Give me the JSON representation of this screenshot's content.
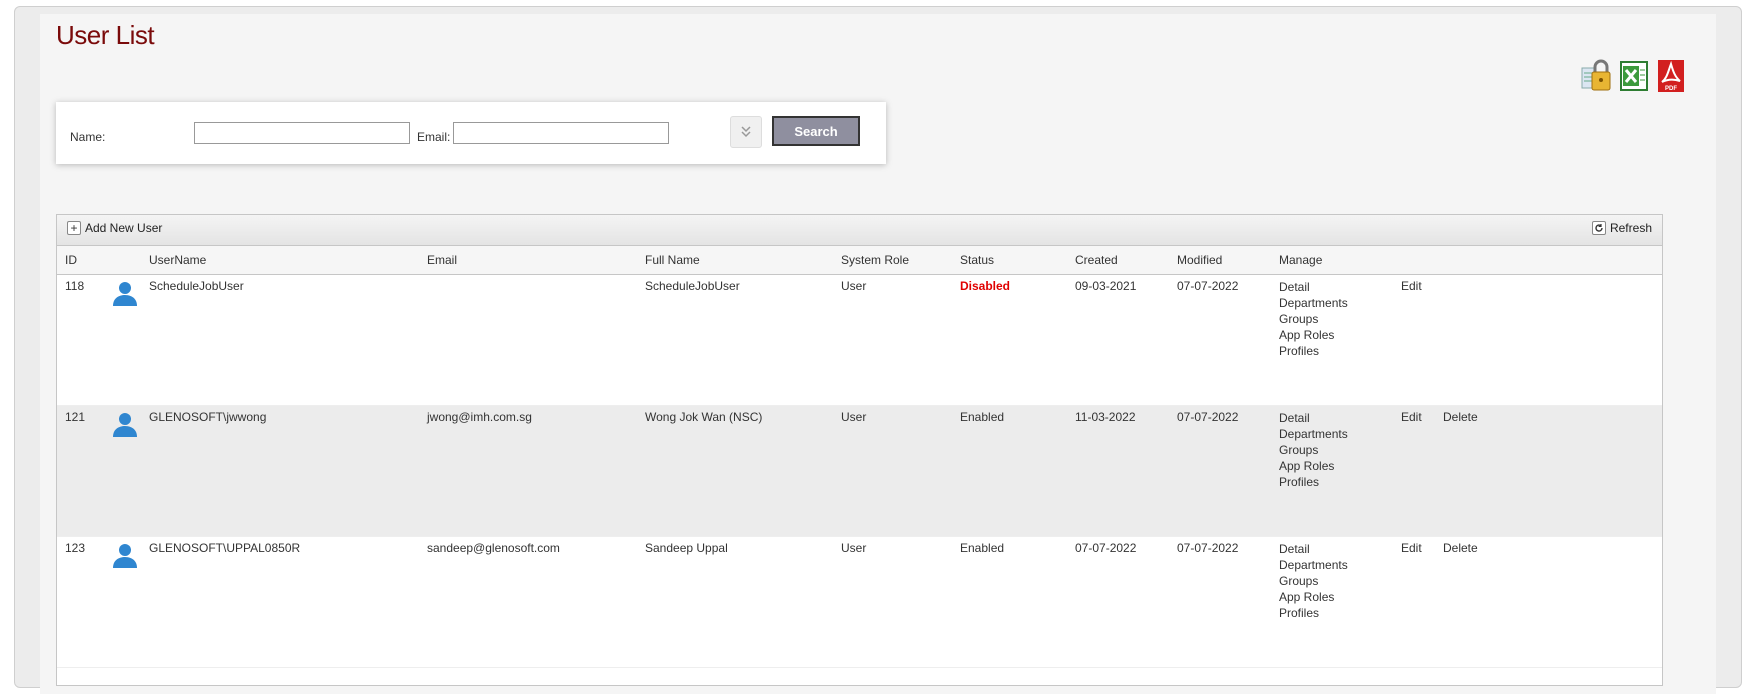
{
  "page": {
    "title": "User List"
  },
  "export_icons": [
    "lock-permissions-icon",
    "excel-export-icon",
    "pdf-export-icon"
  ],
  "search": {
    "name_label": "Name:",
    "name_value": "",
    "email_label": "Email:",
    "email_value": "",
    "expand_icon": "double-chevron-down-icon",
    "button_label": "Search"
  },
  "toolbar": {
    "add_label": "Add New User",
    "refresh_label": "Refresh"
  },
  "columns": [
    "ID",
    "UserName",
    "Email",
    "Full Name",
    "System Role",
    "Status",
    "Created",
    "Modified",
    "Manage"
  ],
  "manage_links": [
    "Detail",
    "Departments",
    "Groups",
    "App Roles",
    "Profiles"
  ],
  "rows": [
    {
      "id": "118",
      "username": "ScheduleJobUser",
      "email": "",
      "full_name": "ScheduleJobUser",
      "role": "User",
      "status": "Disabled",
      "created": "09-03-2021",
      "modified": "07-07-2022",
      "edit": "Edit",
      "delete": ""
    },
    {
      "id": "121",
      "username": "GLENOSOFT\\jwwong",
      "email": "jwong@imh.com.sg",
      "full_name": "Wong Jok Wan (NSC)",
      "role": "User",
      "status": "Enabled",
      "created": "11-03-2022",
      "modified": "07-07-2022",
      "edit": "Edit",
      "delete": "Delete"
    },
    {
      "id": "123",
      "username": "GLENOSOFT\\UPPAL0850R",
      "email": "sandeep@glenosoft.com",
      "full_name": "Sandeep Uppal",
      "role": "User",
      "status": "Enabled",
      "created": "07-07-2022",
      "modified": "07-07-2022",
      "edit": "Edit",
      "delete": "Delete"
    }
  ],
  "colors": {
    "title": "#7a0a0a",
    "disabled": "#e00000",
    "avatar": "#2f86d0",
    "search_button": "#8f8f9f"
  }
}
